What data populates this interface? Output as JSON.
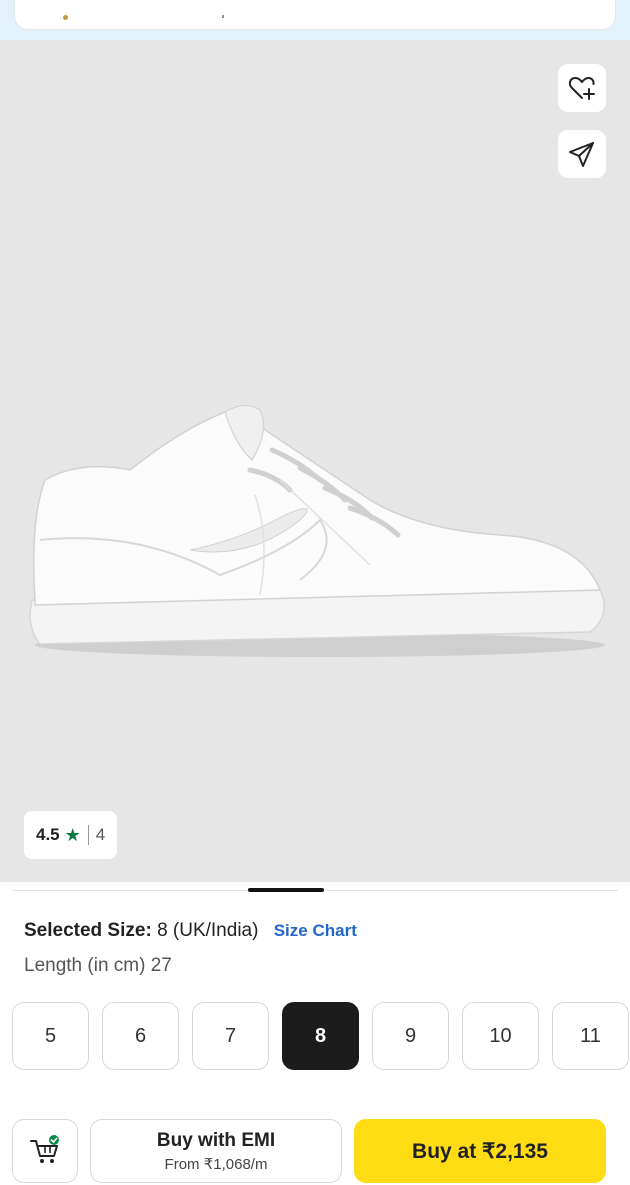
{
  "product": {
    "rating": "4.5",
    "rating_count": "4",
    "icons": [
      "wishlist-heart-plus-icon",
      "share-send-icon",
      "star-icon",
      "cart-check-icon"
    ]
  },
  "size_section": {
    "selected_label": "Selected Size:",
    "selected_value": "8 (UK/India)",
    "size_chart_link": "Size Chart",
    "length_text": "Length (in cm) 27",
    "sizes": [
      "5",
      "6",
      "7",
      "8",
      "9",
      "10",
      "11"
    ],
    "selected_index": 3
  },
  "actions": {
    "emi_title": "Buy with EMI",
    "emi_sub": "From ₹1,068/m",
    "buy_label": "Buy at ₹2,135"
  },
  "colors": {
    "buy_button": "#ffdc14",
    "rating_star": "#0a7a3f",
    "size_chart_link": "#2266cc",
    "selected_size_bg": "#1c1c1c"
  }
}
